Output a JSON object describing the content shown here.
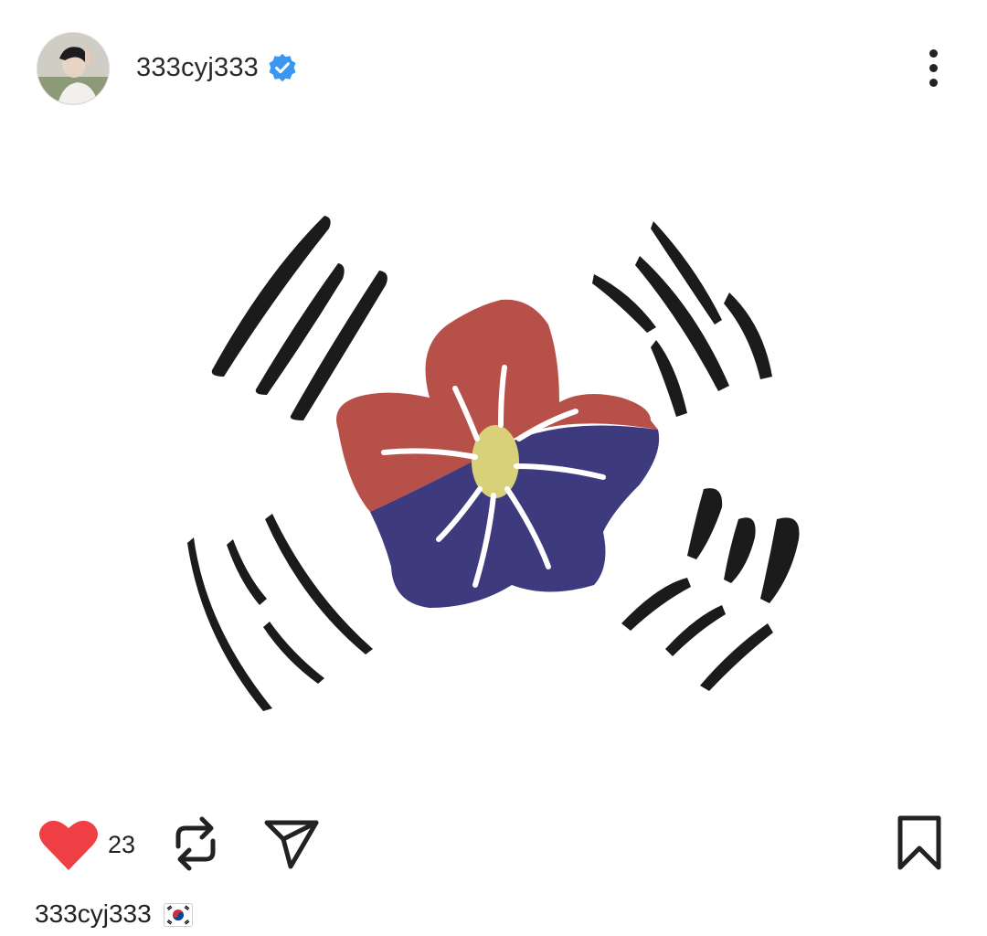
{
  "post": {
    "username": "333cyj333",
    "verified": true,
    "like_count": "23",
    "caption": {
      "username": "333cyj333",
      "emoji": "🇰🇷"
    }
  },
  "icons": {
    "verified": "verified-badge-icon",
    "more": "more-vertical-icon",
    "like": "heart-icon",
    "repost": "repost-icon",
    "share": "send-icon",
    "save": "bookmark-icon"
  },
  "colors": {
    "heart": "#ef3f44",
    "verified": "#3897f0",
    "flower_red": "#b8504a",
    "flower_blue": "#3d3a7e",
    "ink": "#1b1b1b"
  }
}
